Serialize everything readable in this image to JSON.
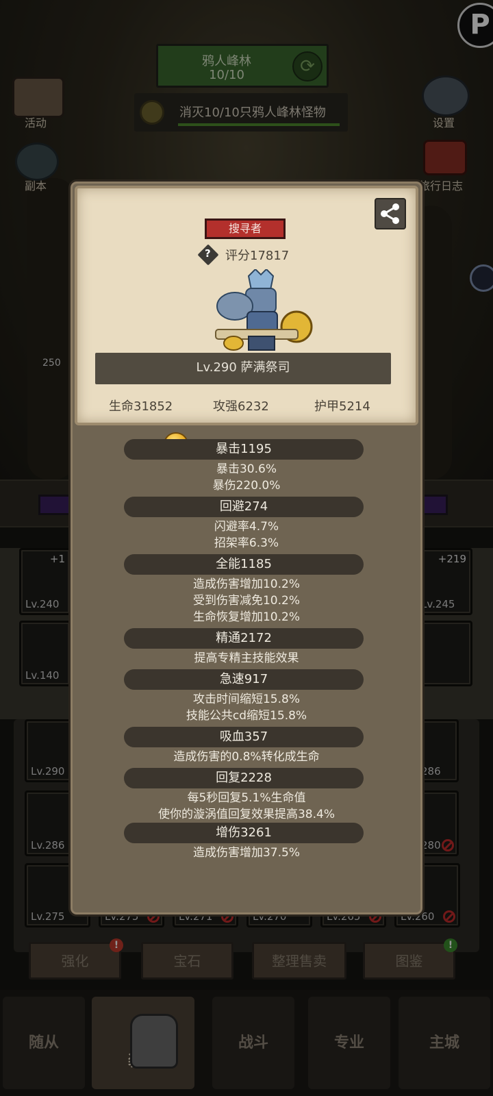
{
  "background": {
    "quest": {
      "name": "鸦人峰林",
      "progress": "10/10",
      "task": "消灭10/10只鸦人峰林怪物"
    },
    "left_menu": [
      {
        "label": "活动"
      },
      {
        "label": "副本"
      }
    ],
    "right_menu": [
      {
        "label": "设置"
      },
      {
        "label": "旅行日志"
      }
    ],
    "side_number": "250",
    "equip_slots": [
      {
        "level": "Lv.240",
        "plus": "+1"
      },
      {
        "level": "Lv.245",
        "plus": "+219"
      },
      {
        "level": "Lv.140"
      }
    ],
    "inventory_levels": [
      "Lv.290",
      "286",
      "Lv.286",
      "280",
      "Lv.275",
      "Lv.275",
      "Lv.271",
      "Lv.270",
      "Lv.265",
      "Lv.260"
    ],
    "action_buttons": [
      {
        "label": "强化",
        "badge": "!"
      },
      {
        "label": "宝石"
      },
      {
        "label": "整理售卖"
      },
      {
        "label": "图鉴",
        "badge": "!"
      }
    ],
    "nav_tabs": [
      "随从",
      "装备",
      "战斗",
      "专业",
      "主城"
    ]
  },
  "popup": {
    "class_tag": "搜寻者",
    "score": "评分17817",
    "name": "Lv.290 萨满祭司",
    "base_stats": {
      "hp": "生命31852",
      "attack": "攻强6232",
      "armor": "护甲5214"
    },
    "stats": [
      {
        "header": "暴击1195",
        "lines": [
          "暴击30.6%",
          "暴伤220.0%"
        ]
      },
      {
        "header": "回避274",
        "lines": [
          "闪避率4.7%",
          "招架率6.3%"
        ]
      },
      {
        "header": "全能1185",
        "lines": [
          "造成伤害增加10.2%",
          "受到伤害减免10.2%",
          "生命恢复增加10.2%"
        ]
      },
      {
        "header": "精通2172",
        "lines": [
          "提高专精主技能效果"
        ]
      },
      {
        "header": "急速917",
        "lines": [
          "攻击时间缩短15.8%",
          "技能公共cd缩短15.8%"
        ]
      },
      {
        "header": "吸血357",
        "lines": [
          "造成伤害的0.8%转化成生命"
        ]
      },
      {
        "header": "回复2228",
        "lines": [
          "每5秒回复5.1%生命值",
          "使你的漩涡值回复效果提高38.4%"
        ]
      },
      {
        "header": "增伤3261",
        "lines": [
          "造成伤害增加37.5%"
        ]
      }
    ]
  }
}
